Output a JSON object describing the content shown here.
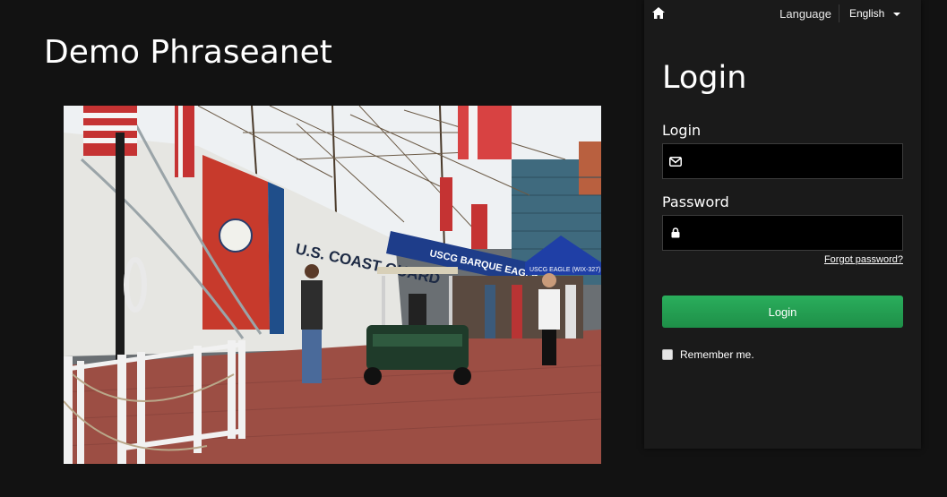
{
  "app": {
    "title": "Demo Phraseanet"
  },
  "topbar": {
    "home_icon": "home-icon",
    "language_label": "Language",
    "language_value": "English",
    "caret_icon": "caret-down-icon"
  },
  "login": {
    "heading": "Login",
    "login_label": "Login",
    "login_icon": "envelope-icon",
    "login_value": "",
    "password_label": "Password",
    "password_icon": "lock-icon",
    "password_value": "",
    "forgot_link": "Forgot password?",
    "submit_label": "Login",
    "remember_label": "Remember me.",
    "remember_checked": false
  },
  "colors": {
    "background": "#121212",
    "panel": "#1a1a1a",
    "input_background": "#000000",
    "button": "#23a052"
  },
  "hero_image": {
    "painted_text": {
      "hull": "U.S. COAST GUARD",
      "banner": "USCG BARQUE EAGLE",
      "tent_sign": "USCG EAGLE (WIX-327)"
    }
  }
}
